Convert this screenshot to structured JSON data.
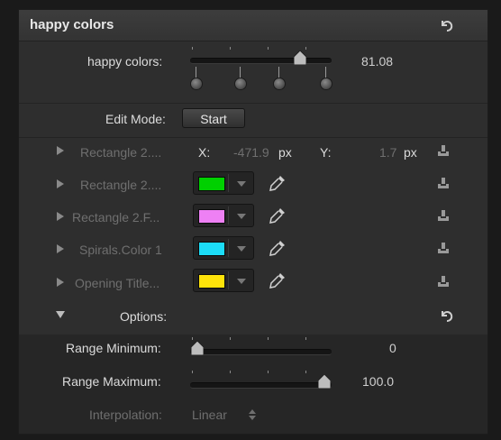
{
  "panel": {
    "title": "happy colors"
  },
  "slider": {
    "label": "happy colors:",
    "value": "81.08",
    "level": 0.81
  },
  "edit_mode": {
    "label": "Edit Mode:",
    "button": "Start"
  },
  "rows": [
    {
      "name": "Rectangle 2....",
      "x_label": "X:",
      "x_value": "-471.9",
      "x_unit": "px",
      "y_label": "Y:",
      "y_value": "1.7",
      "y_unit": "px"
    },
    {
      "name": "Rectangle 2....",
      "color": "#00d000"
    },
    {
      "name": "Rectangle 2.F...",
      "color": "#ee80f4"
    },
    {
      "name": "Spirals.Color 1",
      "color": "#1cdcf7"
    },
    {
      "name": "Opening Title...",
      "color": "#fee30a"
    }
  ],
  "options": {
    "label": "Options:",
    "range_min": {
      "label": "Range Minimum:",
      "value": "0",
      "level": 0.0
    },
    "range_max": {
      "label": "Range Maximum:",
      "value": "100.0",
      "level": 1.0
    },
    "interpolation": {
      "label": "Interpolation:",
      "value": "Linear"
    }
  }
}
